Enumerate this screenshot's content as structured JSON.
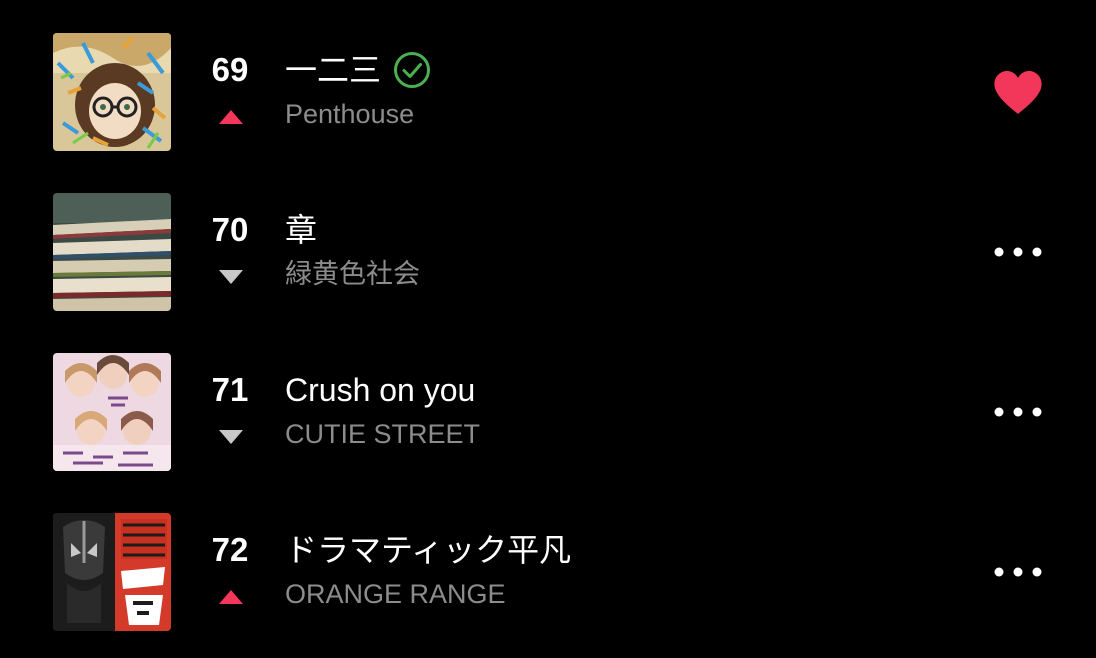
{
  "colors": {
    "background": "#000000",
    "title": "#ffffff",
    "artist": "#8c8c8c",
    "trend_up": "#f2375a",
    "trend_down": "#c8c8c8",
    "verified": "#4caf50",
    "heart": "#f2375a"
  },
  "tracks": [
    {
      "rank": "69",
      "title": "一二三",
      "artist": "Penthouse",
      "trend": "up",
      "verified_icon": "check-circle-icon",
      "action_icon": "heart-filled-icon",
      "liked": true
    },
    {
      "rank": "70",
      "title": "章",
      "artist": "緑黄色社会",
      "trend": "down",
      "action_icon": "more-horizontal-icon"
    },
    {
      "rank": "71",
      "title": "Crush on you",
      "artist": "CUTIE STREET",
      "trend": "down",
      "action_icon": "more-horizontal-icon"
    },
    {
      "rank": "72",
      "title": "ドラマティック平凡",
      "artist": "ORANGE RANGE",
      "trend": "up",
      "action_icon": "more-horizontal-icon"
    }
  ]
}
